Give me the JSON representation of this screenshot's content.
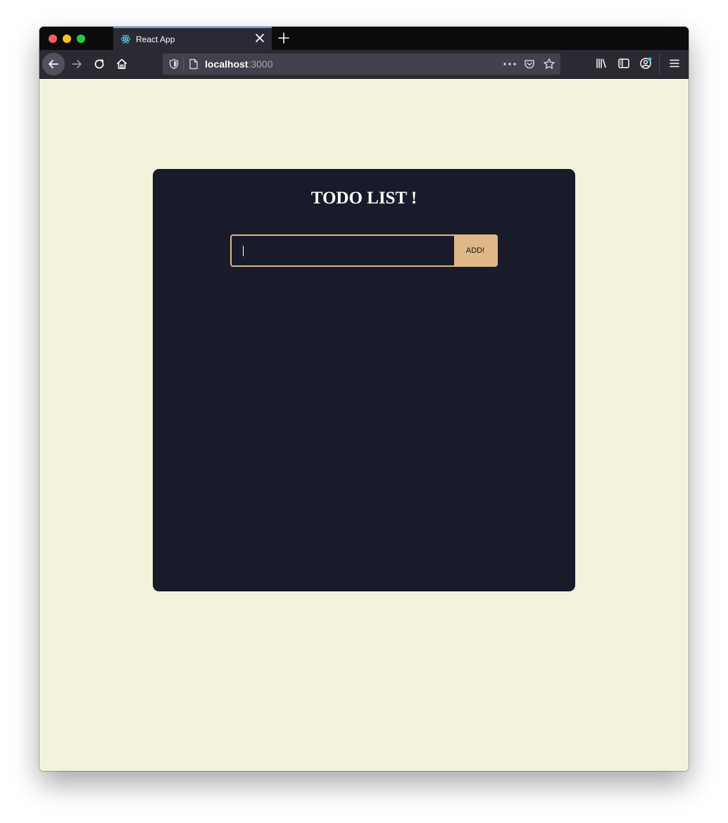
{
  "browser": {
    "tab": {
      "title": "React App",
      "icon": "react-icon"
    },
    "url": {
      "host": "localhost",
      "port": ":3000"
    },
    "colors": {
      "tab_accent": "#54a0f8",
      "chrome": "#2b2a33"
    }
  },
  "app": {
    "title": "TODO LIST !",
    "input": {
      "value": "",
      "placeholder": ""
    },
    "add_label": "ADD!",
    "colors": {
      "background": "#f3f3dc",
      "card": "#1a1b2a",
      "accent": "#deb887"
    }
  }
}
